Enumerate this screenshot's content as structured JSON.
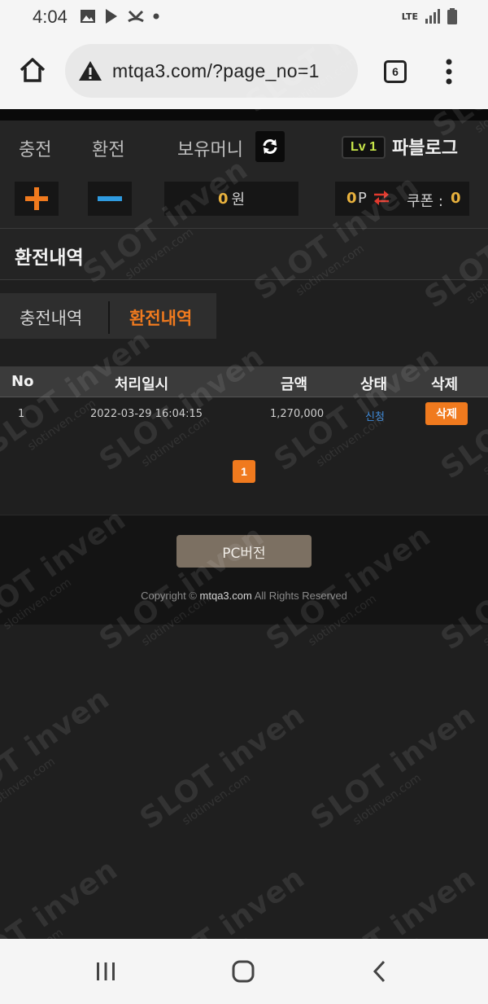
{
  "status_bar": {
    "time": "4:04",
    "network": "LTE"
  },
  "browser": {
    "url": "mtqa3.com/?page_no=1",
    "tab_count": "6"
  },
  "nav": {
    "charge": "충전",
    "exchange": "환전",
    "holding_money": "보유머니",
    "level": "Lv 1",
    "username": "파블로그"
  },
  "wallet": {
    "balance": "0",
    "balance_unit": "원",
    "points": "0",
    "points_unit": "P",
    "coupon_label": "쿠폰 :",
    "coupon_count": "0"
  },
  "section": {
    "title": "환전내역"
  },
  "subtabs": {
    "charge_history": "충전내역",
    "exchange_history": "환전내역"
  },
  "table": {
    "headers": {
      "no": "No",
      "date": "처리일시",
      "amount": "금액",
      "status": "상태",
      "delete": "삭제"
    },
    "rows": [
      {
        "no": "1",
        "date": "2022-03-29 16:04:15",
        "amount": "1,270,000",
        "status": "신청",
        "delete": "삭제"
      }
    ]
  },
  "pagination": {
    "current": "1"
  },
  "footer": {
    "pc_button": "PC버전",
    "copyright_prefix": "Copyright ©",
    "copyright_domain": "mtqa3.com",
    "copyright_suffix": "All Rights Reserved"
  },
  "watermark": {
    "brand": "SLOT inven",
    "site": "slotinven.com"
  },
  "colors": {
    "accent_orange": "#f07a1e",
    "gold": "#e8b13d",
    "status_blue": "#3f8ad8",
    "pc_button": "#7c7062"
  }
}
